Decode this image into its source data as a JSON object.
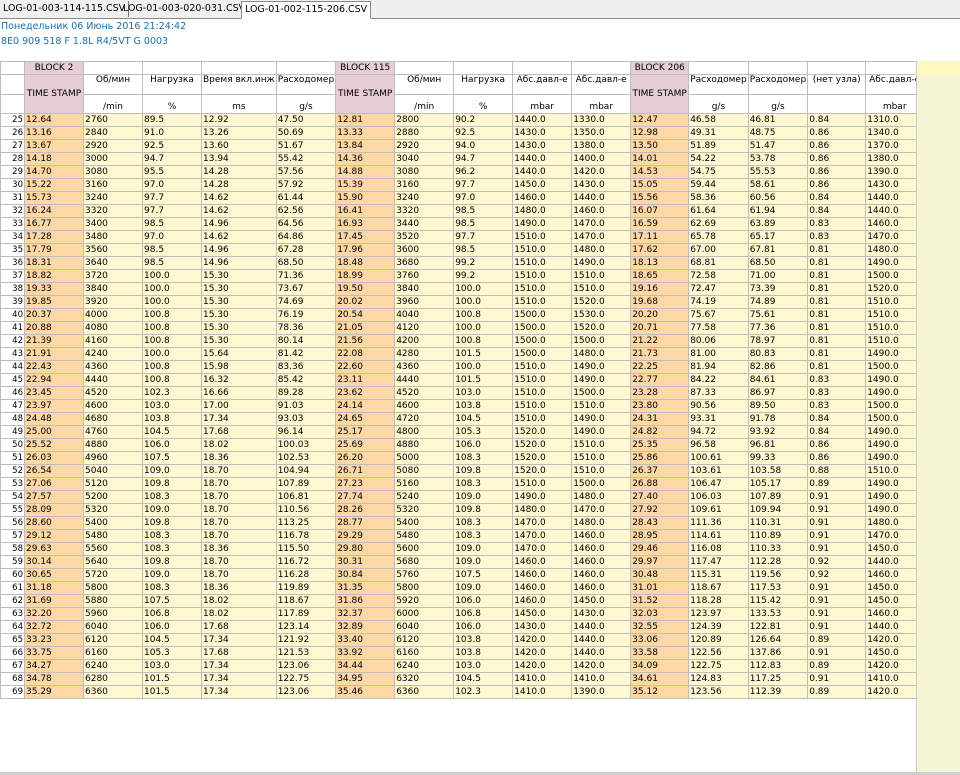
{
  "tabs": [
    "LOG-01-003-114-115.CSV",
    "LOG-01-003-020-031.CSV",
    "LOG-01-002-115-206.CSV"
  ],
  "active_tab": 2,
  "info": {
    "datetime": "Понедельник 06 Июнь 2016 21:24:42",
    "ecu": "8E0 909 518 F  1.8L R4/5VT     G   0003"
  },
  "headers": {
    "blocks": {
      "b2": "BLOCK 2",
      "b115": "BLOCK 115",
      "b206": "BLOCK 206"
    },
    "names": [
      "",
      "Об/мин",
      "Нагрузка",
      "Время вкл.инж",
      "Расходомер",
      "",
      "Об/мин",
      "Нагрузка",
      "Абс.давл-е",
      "Абс.давл-е",
      "",
      "Расходомер",
      "Расходомер",
      "(нет узла)",
      "Абс.давл-е"
    ],
    "units": [
      "",
      "/min",
      "%",
      "ms",
      "g/s",
      "",
      "/min",
      "%",
      "mbar",
      "mbar",
      "",
      "g/s",
      "g/s",
      "",
      "mbar"
    ],
    "timestamp": "TIME STAMP"
  },
  "rows": [
    [
      25,
      "12.64",
      "2760",
      "89.5",
      "12.92",
      "47.50",
      "12.81",
      "2800",
      "90.2",
      "1440.0",
      "1330.0",
      "12.47",
      "46.58",
      "46.81",
      "0.84",
      "1310.0"
    ],
    [
      26,
      "13.16",
      "2840",
      "91.0",
      "13.26",
      "50.69",
      "13.33",
      "2880",
      "92.5",
      "1430.0",
      "1350.0",
      "12.98",
      "49.31",
      "48.75",
      "0.86",
      "1340.0"
    ],
    [
      27,
      "13.67",
      "2920",
      "92.5",
      "13.60",
      "51.67",
      "13.84",
      "2920",
      "94.0",
      "1430.0",
      "1380.0",
      "13.50",
      "51.89",
      "51.47",
      "0.86",
      "1370.0"
    ],
    [
      28,
      "14.18",
      "3000",
      "94.7",
      "13.94",
      "55.42",
      "14.36",
      "3040",
      "94.7",
      "1440.0",
      "1400.0",
      "14.01",
      "54.22",
      "53.78",
      "0.86",
      "1380.0"
    ],
    [
      29,
      "14.70",
      "3080",
      "95.5",
      "14.28",
      "57.56",
      "14.88",
      "3080",
      "96.2",
      "1440.0",
      "1420.0",
      "14.53",
      "54.75",
      "55.53",
      "0.86",
      "1390.0"
    ],
    [
      30,
      "15.22",
      "3160",
      "97.0",
      "14.28",
      "57.92",
      "15.39",
      "3160",
      "97.7",
      "1450.0",
      "1430.0",
      "15.05",
      "59.44",
      "58.61",
      "0.86",
      "1430.0"
    ],
    [
      31,
      "15.73",
      "3240",
      "97.7",
      "14.62",
      "61.44",
      "15.90",
      "3240",
      "97.0",
      "1460.0",
      "1440.0",
      "15.56",
      "58.36",
      "60.56",
      "0.84",
      "1440.0"
    ],
    [
      32,
      "16.24",
      "3320",
      "97.7",
      "14.62",
      "62.56",
      "16.41",
      "3320",
      "98.5",
      "1480.0",
      "1460.0",
      "16.07",
      "61.64",
      "61.94",
      "0.84",
      "1440.0"
    ],
    [
      33,
      "16.77",
      "3400",
      "98.5",
      "14.96",
      "64.56",
      "16.93",
      "3440",
      "98.5",
      "1490.0",
      "1470.0",
      "16.59",
      "62.69",
      "63.89",
      "0.83",
      "1460.0"
    ],
    [
      34,
      "17.28",
      "3480",
      "97.0",
      "14.62",
      "64.86",
      "17.45",
      "3520",
      "97.7",
      "1510.0",
      "1470.0",
      "17.11",
      "65.78",
      "65.17",
      "0.83",
      "1470.0"
    ],
    [
      35,
      "17.79",
      "3560",
      "98.5",
      "14.96",
      "67.28",
      "17.96",
      "3600",
      "98.5",
      "1510.0",
      "1480.0",
      "17.62",
      "67.00",
      "67.81",
      "0.81",
      "1480.0"
    ],
    [
      36,
      "18.31",
      "3640",
      "98.5",
      "14.96",
      "68.50",
      "18.48",
      "3680",
      "99.2",
      "1510.0",
      "1490.0",
      "18.13",
      "68.81",
      "68.50",
      "0.81",
      "1490.0"
    ],
    [
      37,
      "18.82",
      "3720",
      "100.0",
      "15.30",
      "71.36",
      "18.99",
      "3760",
      "99.2",
      "1510.0",
      "1510.0",
      "18.65",
      "72.58",
      "71.00",
      "0.81",
      "1500.0"
    ],
    [
      38,
      "19.33",
      "3840",
      "100.0",
      "15.30",
      "73.67",
      "19.50",
      "3840",
      "100.0",
      "1510.0",
      "1510.0",
      "19.16",
      "72.47",
      "73.39",
      "0.81",
      "1520.0"
    ],
    [
      39,
      "19.85",
      "3920",
      "100.0",
      "15.30",
      "74.69",
      "20.02",
      "3960",
      "100.0",
      "1510.0",
      "1520.0",
      "19.68",
      "74.19",
      "74.89",
      "0.81",
      "1510.0"
    ],
    [
      40,
      "20.37",
      "4000",
      "100.8",
      "15.30",
      "76.19",
      "20.54",
      "4040",
      "100.8",
      "1500.0",
      "1530.0",
      "20.20",
      "75.67",
      "75.61",
      "0.81",
      "1510.0"
    ],
    [
      41,
      "20.88",
      "4080",
      "100.8",
      "15.30",
      "78.36",
      "21.05",
      "4120",
      "100.0",
      "1500.0",
      "1520.0",
      "20.71",
      "77.58",
      "77.36",
      "0.81",
      "1510.0"
    ],
    [
      42,
      "21.39",
      "4160",
      "100.8",
      "15.30",
      "80.14",
      "21.56",
      "4200",
      "100.8",
      "1500.0",
      "1500.0",
      "21.22",
      "80.06",
      "78.97",
      "0.81",
      "1510.0"
    ],
    [
      43,
      "21.91",
      "4240",
      "100.0",
      "15.64",
      "81.42",
      "22.08",
      "4280",
      "101.5",
      "1500.0",
      "1480.0",
      "21.73",
      "81.00",
      "80.83",
      "0.81",
      "1490.0"
    ],
    [
      44,
      "22.43",
      "4360",
      "100.8",
      "15.98",
      "83.36",
      "22.60",
      "4360",
      "100.0",
      "1510.0",
      "1490.0",
      "22.25",
      "81.94",
      "82.86",
      "0.81",
      "1500.0"
    ],
    [
      45,
      "22.94",
      "4440",
      "100.8",
      "16.32",
      "85.42",
      "23.11",
      "4440",
      "101.5",
      "1510.0",
      "1490.0",
      "22.77",
      "84.22",
      "84.61",
      "0.83",
      "1490.0"
    ],
    [
      46,
      "23.45",
      "4520",
      "102.3",
      "16.66",
      "89.28",
      "23.62",
      "4520",
      "103.0",
      "1510.0",
      "1500.0",
      "23.28",
      "87.33",
      "86.97",
      "0.83",
      "1490.0"
    ],
    [
      47,
      "23.97",
      "4600",
      "103.0",
      "17.00",
      "91.03",
      "24.14",
      "4600",
      "103.8",
      "1510.0",
      "1510.0",
      "23.80",
      "90.56",
      "89.50",
      "0.83",
      "1500.0"
    ],
    [
      48,
      "24.48",
      "4680",
      "103.8",
      "17.34",
      "93.03",
      "24.65",
      "4720",
      "104.5",
      "1510.0",
      "1490.0",
      "24.31",
      "93.31",
      "91.78",
      "0.84",
      "1500.0"
    ],
    [
      49,
      "25.00",
      "4760",
      "104.5",
      "17.68",
      "96.14",
      "25.17",
      "4800",
      "105.3",
      "1520.0",
      "1490.0",
      "24.82",
      "94.72",
      "93.92",
      "0.84",
      "1490.0"
    ],
    [
      50,
      "25.52",
      "4880",
      "106.0",
      "18.02",
      "100.03",
      "25.69",
      "4880",
      "106.0",
      "1520.0",
      "1510.0",
      "25.35",
      "96.58",
      "96.81",
      "0.86",
      "1490.0"
    ],
    [
      51,
      "26.03",
      "4960",
      "107.5",
      "18.36",
      "102.53",
      "26.20",
      "5000",
      "108.3",
      "1520.0",
      "1510.0",
      "25.86",
      "100.61",
      "99.33",
      "0.86",
      "1490.0"
    ],
    [
      52,
      "26.54",
      "5040",
      "109.0",
      "18.70",
      "104.94",
      "26.71",
      "5080",
      "109.8",
      "1520.0",
      "1510.0",
      "26.37",
      "103.61",
      "103.58",
      "0.88",
      "1510.0"
    ],
    [
      53,
      "27.06",
      "5120",
      "109.8",
      "18.70",
      "107.89",
      "27.23",
      "5160",
      "108.3",
      "1510.0",
      "1500.0",
      "26.88",
      "106.47",
      "105.17",
      "0.89",
      "1490.0"
    ],
    [
      54,
      "27.57",
      "5200",
      "108.3",
      "18.70",
      "106.81",
      "27.74",
      "5240",
      "109.0",
      "1490.0",
      "1480.0",
      "27.40",
      "106.03",
      "107.89",
      "0.91",
      "1490.0"
    ],
    [
      55,
      "28.09",
      "5320",
      "109.0",
      "18.70",
      "110.56",
      "28.26",
      "5320",
      "109.8",
      "1480.0",
      "1470.0",
      "27.92",
      "109.61",
      "109.94",
      "0.91",
      "1490.0"
    ],
    [
      56,
      "28.60",
      "5400",
      "109.8",
      "18.70",
      "113.25",
      "28.77",
      "5400",
      "108.3",
      "1470.0",
      "1480.0",
      "28.43",
      "111.36",
      "110.31",
      "0.91",
      "1480.0"
    ],
    [
      57,
      "29.12",
      "5480",
      "108.3",
      "18.70",
      "116.78",
      "29.29",
      "5480",
      "108.3",
      "1470.0",
      "1460.0",
      "28.95",
      "114.61",
      "110.89",
      "0.91",
      "1470.0"
    ],
    [
      58,
      "29.63",
      "5560",
      "108.3",
      "18.36",
      "115.50",
      "29.80",
      "5600",
      "109.0",
      "1470.0",
      "1460.0",
      "29.46",
      "116.08",
      "110.33",
      "0.91",
      "1450.0"
    ],
    [
      59,
      "30.14",
      "5640",
      "109.8",
      "18.70",
      "116.72",
      "30.31",
      "5680",
      "109.0",
      "1460.0",
      "1460.0",
      "29.97",
      "117.47",
      "112.28",
      "0.92",
      "1440.0"
    ],
    [
      60,
      "30.65",
      "5720",
      "109.0",
      "18.70",
      "116.28",
      "30.84",
      "5760",
      "107.5",
      "1460.0",
      "1460.0",
      "30.48",
      "115.31",
      "119.56",
      "0.92",
      "1460.0"
    ],
    [
      61,
      "31.18",
      "5800",
      "108.3",
      "18.36",
      "119.89",
      "31.35",
      "5800",
      "109.0",
      "1460.0",
      "1460.0",
      "31.01",
      "118.67",
      "117.53",
      "0.91",
      "1450.0"
    ],
    [
      62,
      "31.69",
      "5880",
      "107.5",
      "18.02",
      "118.67",
      "31.86",
      "5920",
      "106.0",
      "1460.0",
      "1450.0",
      "31.52",
      "118.28",
      "115.42",
      "0.91",
      "1450.0"
    ],
    [
      63,
      "32.20",
      "5960",
      "106.8",
      "18.02",
      "117.89",
      "32.37",
      "6000",
      "106.8",
      "1450.0",
      "1430.0",
      "32.03",
      "123.97",
      "133.53",
      "0.91",
      "1460.0"
    ],
    [
      64,
      "32.72",
      "6040",
      "106.0",
      "17.68",
      "123.14",
      "32.89",
      "6040",
      "106.0",
      "1430.0",
      "1440.0",
      "32.55",
      "124.39",
      "122.81",
      "0.91",
      "1440.0"
    ],
    [
      65,
      "33.23",
      "6120",
      "104.5",
      "17.34",
      "121.92",
      "33.40",
      "6120",
      "103.8",
      "1420.0",
      "1440.0",
      "33.06",
      "120.89",
      "126.64",
      "0.89",
      "1420.0"
    ],
    [
      66,
      "33.75",
      "6160",
      "105.3",
      "17.68",
      "121.53",
      "33.92",
      "6160",
      "103.8",
      "1420.0",
      "1440.0",
      "33.58",
      "122.56",
      "137.86",
      "0.91",
      "1450.0"
    ],
    [
      67,
      "34.27",
      "6240",
      "103.0",
      "17.34",
      "123.06",
      "34.44",
      "6240",
      "103.0",
      "1420.0",
      "1420.0",
      "34.09",
      "122.75",
      "112.83",
      "0.89",
      "1420.0"
    ],
    [
      68,
      "34.78",
      "6280",
      "101.5",
      "17.34",
      "122.75",
      "34.95",
      "6320",
      "104.5",
      "1410.0",
      "1410.0",
      "34.61",
      "124.83",
      "117.25",
      "0.91",
      "1410.0"
    ],
    [
      69,
      "35.29",
      "6360",
      "101.5",
      "17.34",
      "123.06",
      "35.46",
      "6360",
      "102.3",
      "1410.0",
      "1390.0",
      "35.12",
      "123.56",
      "112.39",
      "0.89",
      "1420.0"
    ]
  ]
}
